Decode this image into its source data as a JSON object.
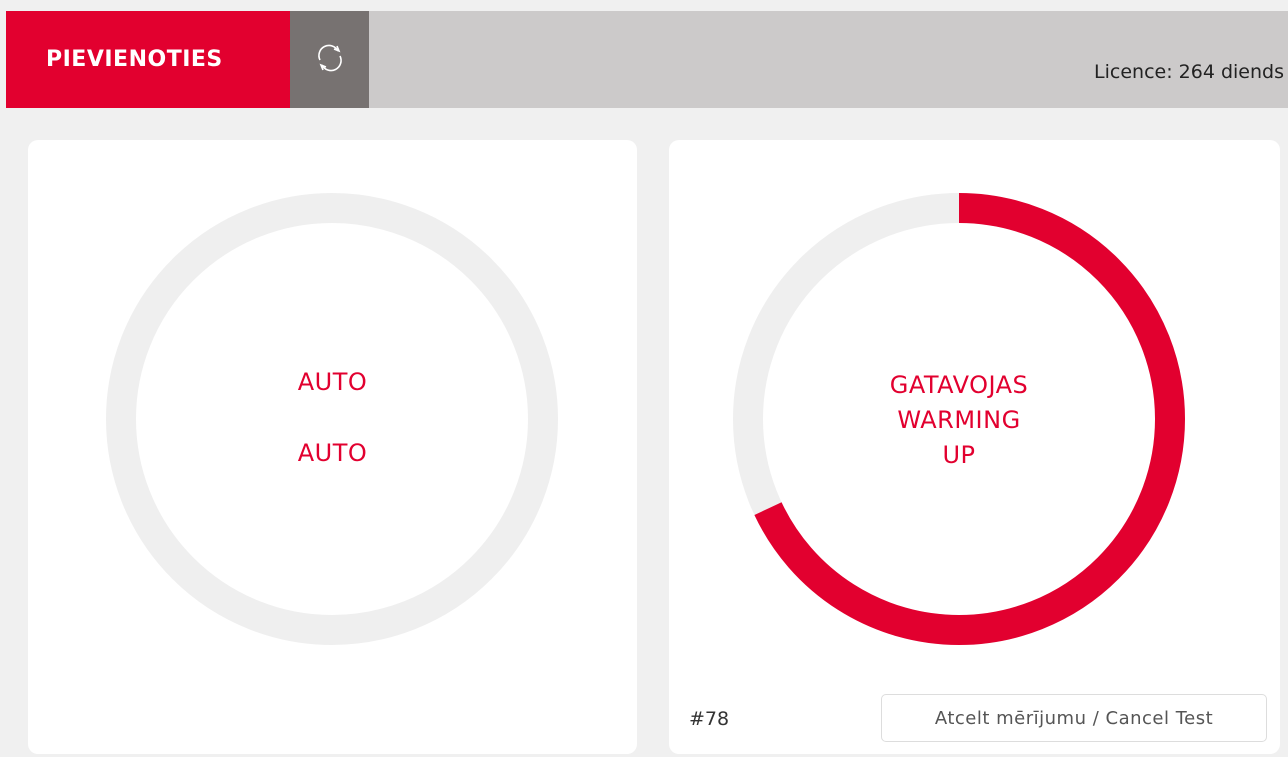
{
  "header": {
    "connect_label": "PIEVIENOTIES",
    "refresh_icon": "refresh-icon",
    "license_text": "Licence: 264 diends"
  },
  "left_panel": {
    "line1": "AUTO",
    "line2": "AUTO",
    "progress": 0
  },
  "right_panel": {
    "status_lines": [
      "GATAVOJAS",
      "WARMING",
      "UP"
    ],
    "progress": 0.68,
    "test_id": "#78",
    "cancel_label": "Atcelt mērījumu / Cancel Test"
  },
  "colors": {
    "accent": "#e2002f",
    "track": "#efefef",
    "header_bg": "#cccaca",
    "refresh_bg": "#777271"
  }
}
